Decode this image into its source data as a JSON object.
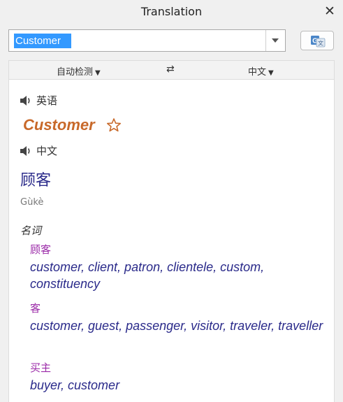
{
  "window": {
    "title": "Translation"
  },
  "search": {
    "value": "Customer"
  },
  "langbar": {
    "source": "自动检测",
    "target": "中文"
  },
  "result": {
    "source_lang": "英语",
    "source_word": "Customer",
    "target_lang": "中文",
    "target_word": "顾客",
    "pinyin": "Gùkè",
    "part_of_speech": "名词",
    "senses": [
      {
        "zh": "顾客",
        "en": "customer, client, patron, clientele, custom, constituency"
      },
      {
        "zh": "客",
        "en": "customer, guest, passenger, visitor, traveler, traveller"
      },
      {
        "zh": "买主",
        "en": "buyer, customer"
      }
    ]
  },
  "colors": {
    "source_word": "#c8692a",
    "sense_zh": "#9b2aa8",
    "sense_en": "#2a2a8a",
    "selection": "#3399ff",
    "translate_icon": "#4a86c8"
  }
}
